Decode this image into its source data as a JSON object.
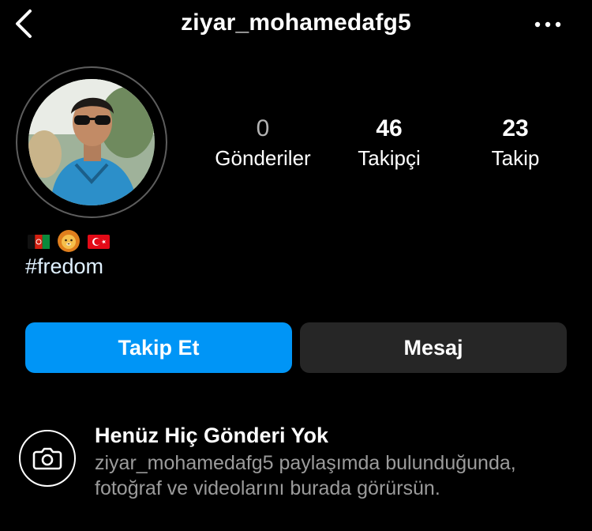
{
  "header": {
    "username": "ziyar_mohamedafg5",
    "back_icon": "chevron-left-icon",
    "more_icon": "more-horizontal-icon"
  },
  "profile": {
    "avatar": "profile-photo",
    "stats": [
      {
        "value": "0",
        "label": "Gönderiler"
      },
      {
        "value": "46",
        "label": "Takipçi"
      },
      {
        "value": "23",
        "label": "Takip"
      }
    ],
    "emojis": [
      "afghanistan-flag",
      "lion-face",
      "turkey-flag"
    ],
    "bio": "#fredom"
  },
  "actions": {
    "follow_label": "Takip Et",
    "message_label": "Mesaj"
  },
  "empty_state": {
    "icon": "camera-icon",
    "title": "Henüz Hiç Gönderi Yok",
    "description": "ziyar_mohamedafg5 paylaşımda bulunduğunda, fotoğraf ve videolarını burada görürsün."
  },
  "colors": {
    "background": "#000000",
    "primary_button": "#0095f6",
    "secondary_button": "#262626",
    "muted_text": "#9b9b9b"
  }
}
